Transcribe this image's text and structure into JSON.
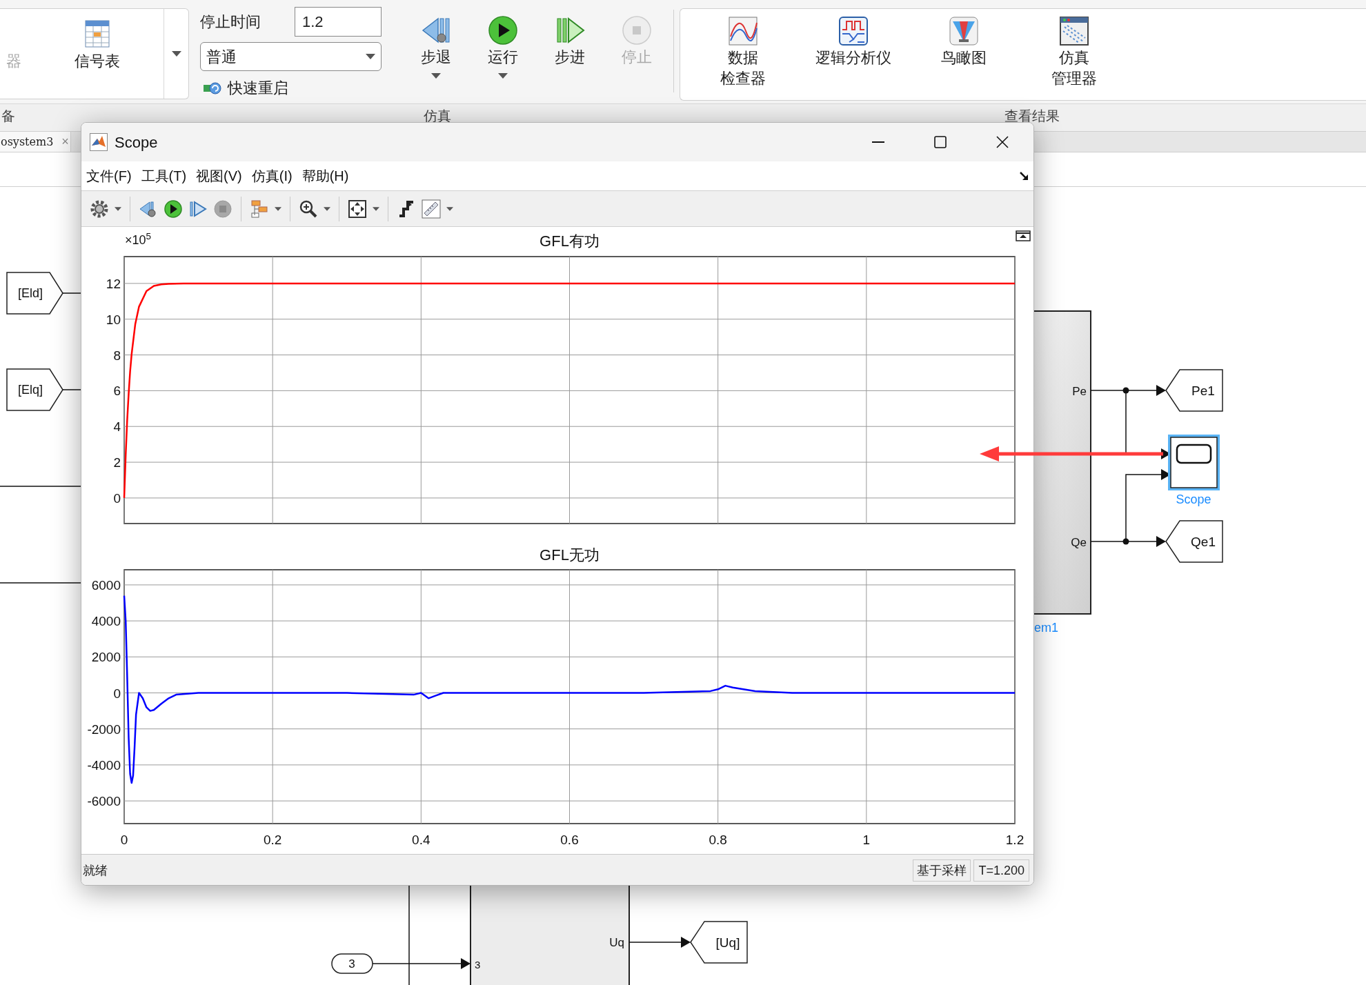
{
  "ribbon": {
    "prepare": {
      "section_label": "备",
      "items": [
        {
          "label": "器",
          "disabled": true
        },
        {
          "label": "信号表",
          "disabled": false
        }
      ]
    },
    "simulate": {
      "section_label": "仿真",
      "stop_time_label": "停止时间",
      "stop_time": "1.2",
      "mode": "普通",
      "fast_restart_label": "快速重启",
      "buttons": [
        {
          "kind": "step_back",
          "label": "步退",
          "disabled": false,
          "menu": true
        },
        {
          "kind": "run",
          "label": "运行",
          "disabled": false,
          "menu": true
        },
        {
          "kind": "step_forward",
          "label": "步进",
          "disabled": false,
          "menu": false
        },
        {
          "kind": "stop",
          "label": "停止",
          "disabled": true,
          "menu": false
        }
      ]
    },
    "review": {
      "section_label": "查看结果",
      "items": [
        {
          "kind": "inspector",
          "lines": [
            "数据",
            "检查器"
          ]
        },
        {
          "kind": "logic",
          "lines": [
            "逻辑分析仪"
          ]
        },
        {
          "kind": "birdseye",
          "lines": [
            "鸟瞰图"
          ]
        },
        {
          "kind": "manager",
          "lines": [
            "仿真",
            "管理器"
          ]
        }
      ]
    }
  },
  "editor_tab": {
    "label": "osystem3",
    "close": "×"
  },
  "scope_window": {
    "title": "Scope",
    "menu": [
      "文件(F)",
      "工具(T)",
      "视图(V)",
      "仿真(I)",
      "帮助(H)"
    ],
    "plots": [
      {
        "y_multiplier": "×10$^{5}$",
        "chart_data": {
          "type": "line",
          "title": "GFL有功",
          "grid": true,
          "x": [
            0,
            0.002,
            0.004,
            0.006,
            0.008,
            0.01,
            0.015,
            0.02,
            0.03,
            0.04,
            0.05,
            0.06,
            0.08,
            0.1,
            0.2,
            0.4,
            0.6,
            0.8,
            1.0,
            1.2
          ],
          "series": [
            {
              "color": "#ff0000",
              "values": [
                0,
                2.39,
                4.31,
                5.84,
                7.07,
                8.05,
                9.73,
                10.7,
                11.57,
                11.86,
                11.95,
                11.98,
                12,
                12,
                12,
                12,
                12,
                12,
                12,
                12
              ]
            }
          ],
          "xlim": [
            0,
            1.2
          ],
          "ylim": [
            -1.43,
            13.5
          ],
          "yticks": [
            0,
            2,
            4,
            6,
            8,
            10,
            12
          ]
        }
      },
      {
        "chart_data": {
          "type": "line",
          "title": "GFL无功",
          "grid": true,
          "x": [
            0,
            0.002,
            0.004,
            0.006,
            0.008,
            0.01,
            0.012,
            0.014,
            0.016,
            0.02,
            0.025,
            0.03,
            0.035,
            0.04,
            0.05,
            0.06,
            0.07,
            0.1,
            0.2,
            0.3,
            0.39,
            0.4,
            0.41,
            0.42,
            0.43,
            0.5,
            0.6,
            0.7,
            0.79,
            0.8,
            0.81,
            0.82,
            0.85,
            0.9,
            1.0,
            1.1,
            1.2
          ],
          "series": [
            {
              "color": "#0000ff",
              "values": [
                5400,
                4000,
                1000,
                -2500,
                -4500,
                -5000,
                -4600,
                -3000,
                -1200,
                0,
                -300,
                -800,
                -1000,
                -950,
                -600,
                -300,
                -100,
                0,
                0,
                0,
                -100,
                0,
                -300,
                -150,
                0,
                0,
                0,
                0,
                100,
                200,
                400,
                300,
                100,
                0,
                0,
                0,
                0
              ]
            }
          ],
          "xlim": [
            0,
            1.2
          ],
          "ylim": [
            -7260,
            6840
          ],
          "xticks": [
            0,
            0.2,
            0.4,
            0.6,
            0.8,
            1,
            1.2
          ],
          "yticks": [
            -6000,
            -4000,
            -2000,
            0,
            2000,
            4000,
            6000
          ]
        }
      }
    ],
    "status_bar": {
      "message": "就绪",
      "mode": "基于采样",
      "time": "T=1.200"
    }
  },
  "model": {
    "goto_tags": [
      "[Eld]",
      "[Elq]"
    ],
    "subsystem": {
      "label": "em1",
      "ports": [
        "Pe",
        "Qe"
      ]
    },
    "outputs": [
      "Pe1",
      "Qe1"
    ],
    "scope_block": {
      "label": "Scope",
      "selected": true
    },
    "inport": {
      "value": "3",
      "port_label": "3"
    },
    "lower_subsystem": {
      "port_label": "Uq"
    },
    "uq_goto": "[Uq]"
  }
}
